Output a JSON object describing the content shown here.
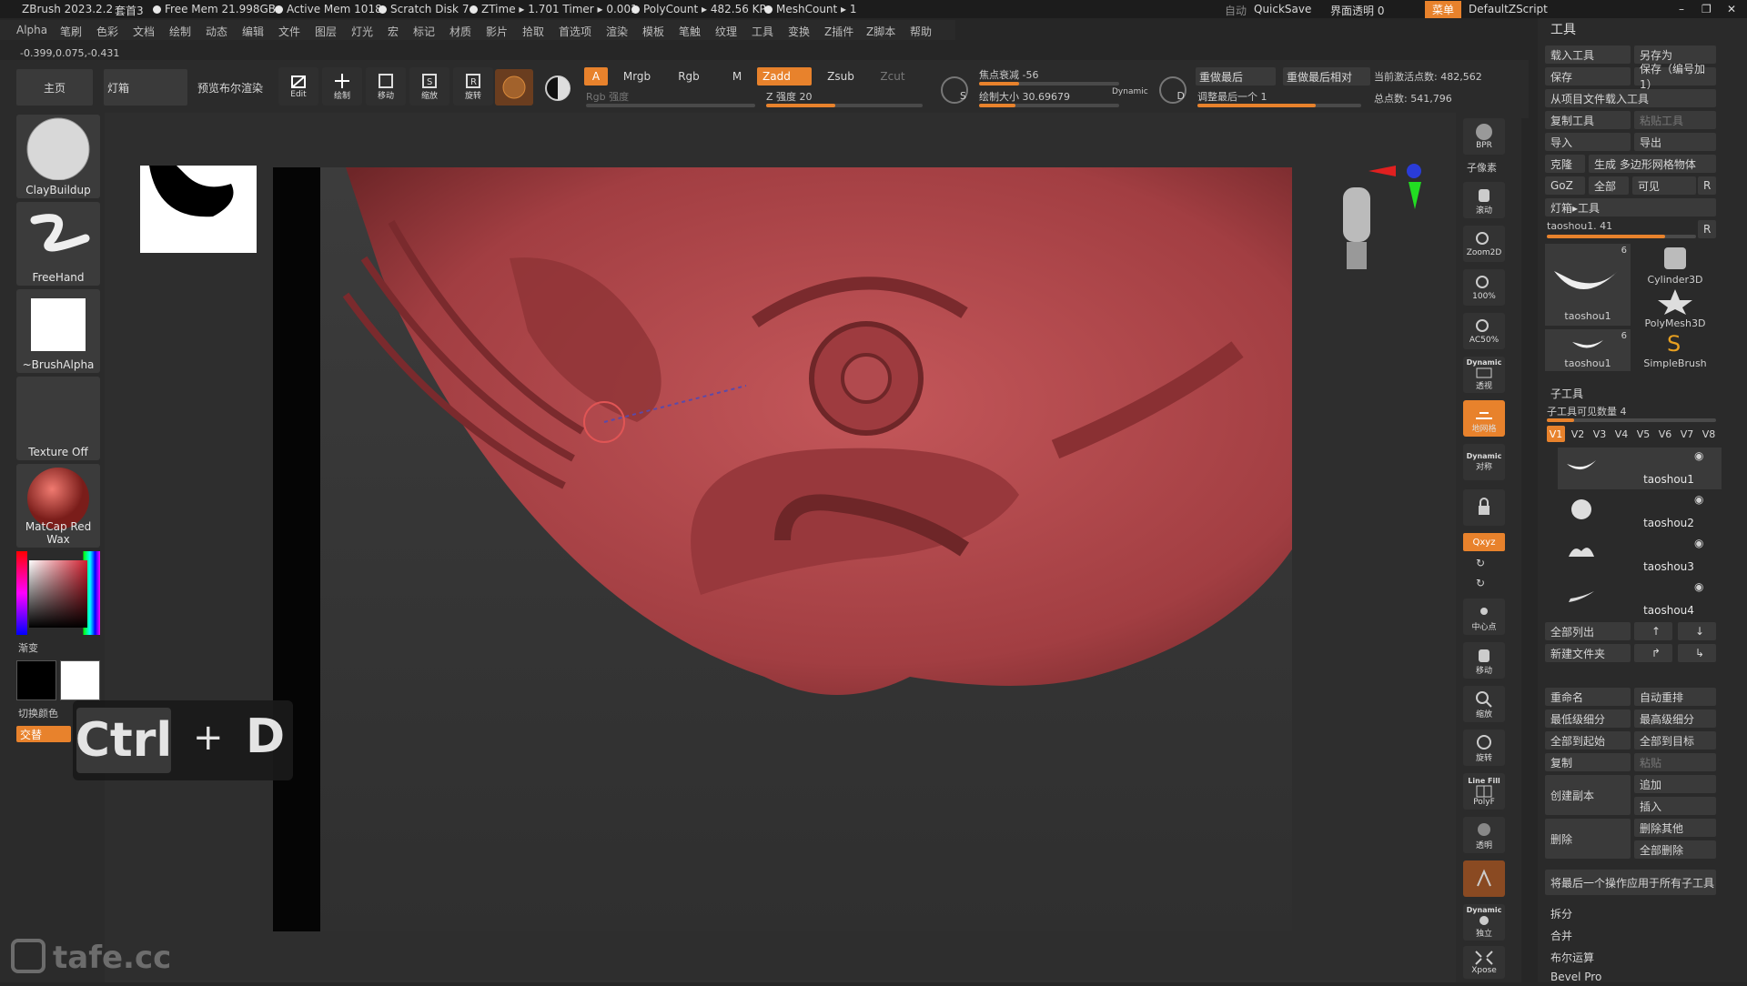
{
  "titlebar": {
    "app": "ZBrush 2023.2.2",
    "doc": "套首3",
    "free_mem": "Free Mem 21.998GB",
    "active_mem": "Active Mem 1018",
    "scratch": "Scratch Disk 7",
    "ztime": "ZTime ▸ 1.701 Timer ▸ 0.001",
    "polycount": "PolyCount ▸ 482.56 KP",
    "meshcount": "MeshCount ▸ 1",
    "auto": "自动",
    "quicksave": "QuickSave",
    "transparency": "界面透明 0",
    "menu": "菜单",
    "script": "DefaultZScript"
  },
  "coords": "-0.399,0.075,-0.431",
  "menubar": [
    "Alpha",
    "笔刷",
    "色彩",
    "文档",
    "绘制",
    "动态",
    "编辑",
    "文件",
    "图层",
    "灯光",
    "宏",
    "标记",
    "材质",
    "影片",
    "拾取",
    "首选项",
    "渲染",
    "模板",
    "笔触",
    "纹理",
    "工具",
    "变换",
    "Z插件",
    "Z脚本",
    "帮助"
  ],
  "top": {
    "home": "主页",
    "lightbox": "灯箱",
    "preview": "预览布尔渲染",
    "edit": "Edit",
    "draw": "绘制",
    "move": "移动",
    "scale": "缩放",
    "rotate": "旋转",
    "A": "A",
    "mrgb": "Mrgb",
    "rgb": "Rgb",
    "m": "M",
    "zadd": "Zadd",
    "zsub": "Zsub",
    "zcut": "Zcut",
    "rgb_intensity": "Rgb 强度",
    "z_intensity": "Z 强度 20",
    "focal": "焦点衰减 -56",
    "draw_size": "绘制大小 30.69679",
    "dynamic": "Dynamic",
    "redo_last": "重做最后",
    "redo_last_rel": "重做最后相对",
    "adjust_last": "调整最后一个 1",
    "active_points": "当前激活点数: 482,562",
    "total_points": "总点数: 541,796"
  },
  "left": {
    "brush1": "ClayBuildup",
    "brush2": "FreeHand",
    "brush3": "~BrushAlpha",
    "texture": "Texture Off",
    "material": "MatCap Red Wax",
    "gradient": "渐变",
    "switch_color": "切换颜色",
    "alternate": "交替"
  },
  "shortcut": {
    "k1": "Ctrl",
    "plus": "+",
    "k2": "D"
  },
  "watermark": "tafe.cc",
  "right": {
    "bpr": "BPR",
    "subpixel": "子像素",
    "scroll": "滚动",
    "zoom2d": "Zoom2D",
    "p100": "100%",
    "ac50": "AC50%",
    "dynamic": "Dynamic",
    "persp": "透视",
    "floor": "地网格",
    "local": "对称",
    "xyz": "Qxyz",
    "center": "中心点",
    "move": "移动",
    "zoom": "缩放",
    "rotate": "旋转",
    "linefill": "Line Fill",
    "polyf": "PolyF",
    "transp": "透明",
    "solo": "独立",
    "xpose": "Xpose"
  },
  "panel": {
    "title": "工具",
    "load": "载入工具",
    "saveas": "另存为",
    "save": "保存",
    "save_inc": "保存（编号加1）",
    "load_proj": "从项目文件载入工具",
    "copy_tool": "复制工具",
    "paste_tool": "粘贴工具",
    "import": "导入",
    "export": "导出",
    "clone": "克隆",
    "make_poly": "生成 多边形网格物体",
    "goz": "GoZ",
    "all": "全部",
    "visible": "可见",
    "r": "R",
    "lightbox_tool": "灯箱▸工具",
    "current_tool": "taoshou1. 41",
    "thumbs": [
      "taoshou1",
      "Cylinder3D",
      "PolyMesh3D",
      "taoshou1",
      "SimpleBrush"
    ],
    "count6": "6",
    "subtool_header": "子工具",
    "visible_count": "子工具可见数量 4",
    "vtabs": [
      "V1",
      "V2",
      "V3",
      "V4",
      "V5",
      "V6",
      "V7",
      "V8"
    ],
    "subtools": [
      "taoshou1",
      "taoshou2",
      "taoshou3",
      "taoshou4"
    ],
    "list_all": "全部列出",
    "new_folder": "新建文件夹",
    "rename": "重命名",
    "auto_reorder": "自动重排",
    "lowest_sub": "最低级细分",
    "highest_sub": "最高级细分",
    "all_to_start": "全部到起始",
    "all_to_target": "全部到目标",
    "copy": "复制",
    "paste": "粘贴",
    "create_copy": "创建副本",
    "append": "追加",
    "insert": "插入",
    "delete": "删除",
    "delete_others": "删除其他",
    "delete_all": "全部删除",
    "apply_last": "将最后一个操作应用于所有子工具",
    "split": "拆分",
    "merge": "合并",
    "boolean": "布尔运算",
    "bevel": "Bevel Pro"
  },
  "colors": {
    "accent": "#e8822c",
    "model": "#b5464a"
  }
}
